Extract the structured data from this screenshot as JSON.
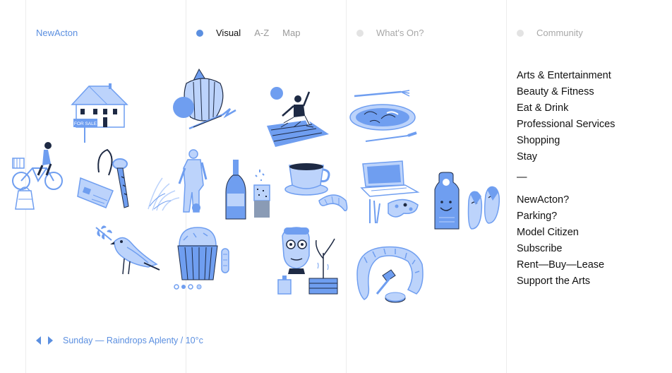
{
  "brand": {
    "name": "NewActon"
  },
  "view_nav": {
    "tabs": [
      {
        "label": "Visual",
        "active": true
      },
      {
        "label": "A-Z",
        "active": false
      },
      {
        "label": "Map",
        "active": false
      }
    ]
  },
  "columns": {
    "whats_on": {
      "label": "What's On?"
    },
    "community": {
      "label": "Community"
    }
  },
  "categories": [
    "Arts & Entertainment",
    "Beauty & Fitness",
    "Eat & Drink",
    "Professional Services",
    "Shopping",
    "Stay"
  ],
  "divider": "—",
  "secondary_links": [
    "NewActon?",
    "Parking?",
    "Model Citizen",
    "Subscribe",
    "Rent—Buy—Lease",
    "Support the Arts"
  ],
  "house_sign": "FOR SALE",
  "weather": {
    "text": "Sunday — Raindrops Aplenty / 10°c"
  },
  "colors": {
    "accent": "#5b8fe0",
    "illustration_blue": "#6f9ef0",
    "illustration_light": "#bcd3fb",
    "ink": "#1e2a44",
    "active_dot": "#5b8fe0",
    "inactive_dot": "#e3e3e3",
    "grid_line": "#ececec"
  },
  "illustrations": [
    "bicycle-rider",
    "house-for-sale",
    "pumpkin-produce",
    "yoga-woman",
    "plate-cutlery",
    "keys-keycard",
    "statue-figure",
    "wine-bottle",
    "coffee-cup",
    "laptop-palette",
    "door-hanger-slippers",
    "bird-branch",
    "cupcake",
    "face-mask-spa",
    "scarf-hammer"
  ]
}
